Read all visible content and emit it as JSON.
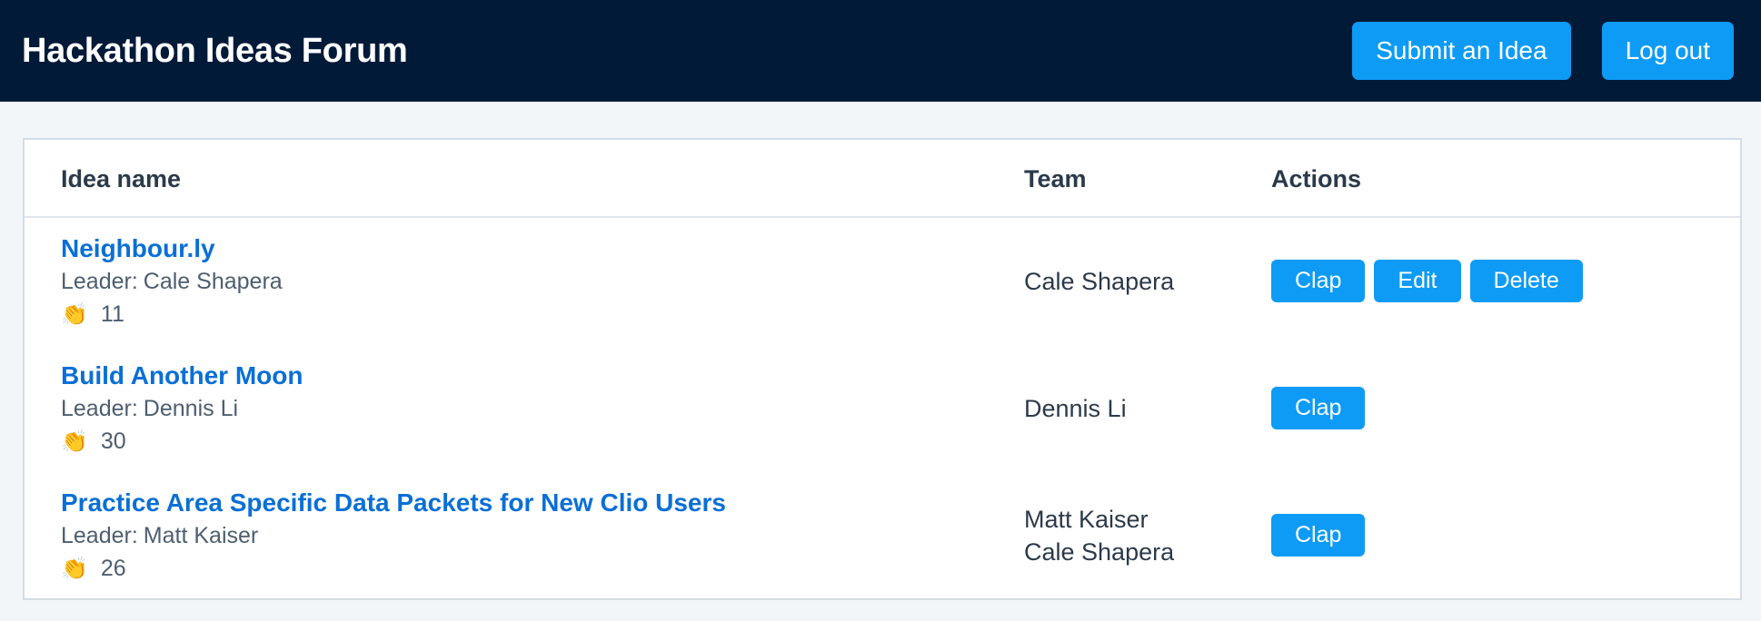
{
  "header": {
    "title": "Hackathon Ideas Forum",
    "submit_label": "Submit an Idea",
    "logout_label": "Log out"
  },
  "table": {
    "columns": [
      "Idea name",
      "Team",
      "Actions"
    ],
    "leader_prefix": "Leader:",
    "rows": [
      {
        "name": "Neighbour.ly",
        "leader": "Cale Shapera",
        "claps": "11",
        "team": [
          "Cale Shapera"
        ],
        "actions": [
          "Clap",
          "Edit",
          "Delete"
        ]
      },
      {
        "name": "Build Another Moon",
        "leader": "Dennis Li",
        "claps": "30",
        "team": [
          "Dennis Li"
        ],
        "actions": [
          "Clap"
        ]
      },
      {
        "name": "Practice Area Specific Data Packets for New Clio Users",
        "leader": "Matt Kaiser",
        "claps": "26",
        "team": [
          "Matt Kaiser",
          "Cale Shapera"
        ],
        "actions": [
          "Clap"
        ]
      }
    ]
  },
  "icons": {
    "clap": "clapping-hands-icon"
  },
  "colors": {
    "header_bg": "#001a38",
    "button": "#0e9bf5",
    "link": "#0a6fd6",
    "page_bg": "#f3f6f9"
  }
}
